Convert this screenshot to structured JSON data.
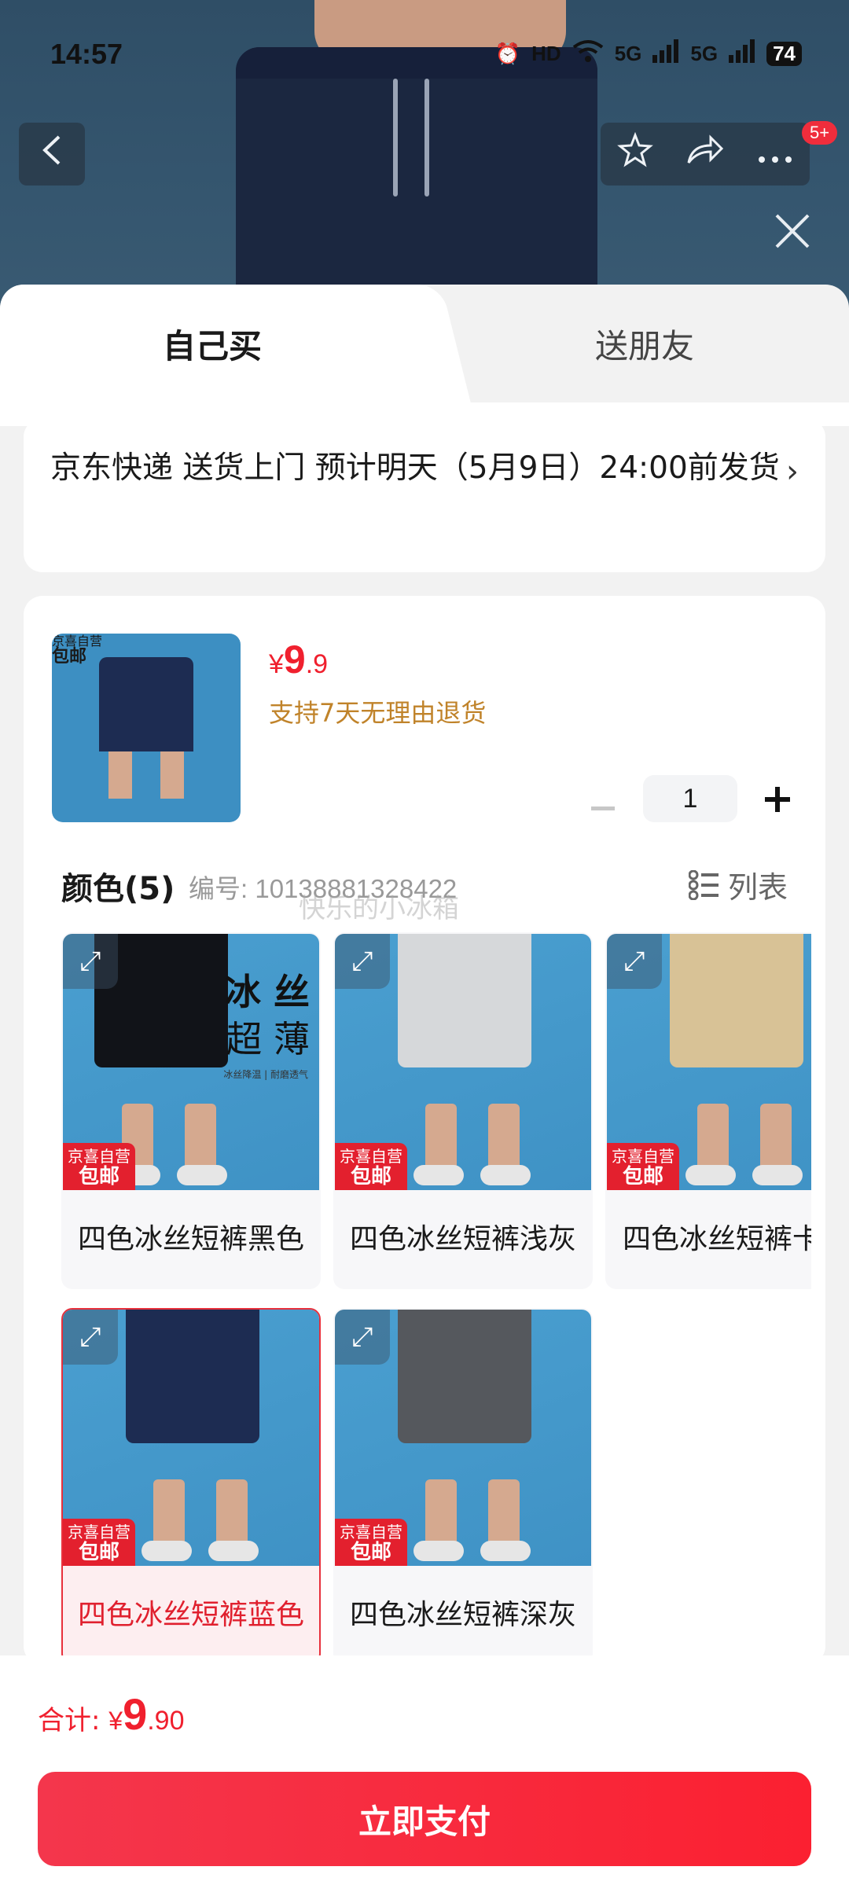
{
  "status_bar": {
    "time": "14:57",
    "battery": "74",
    "network": "5G",
    "hd": "HD"
  },
  "nav": {
    "back_icon": "chevron-left-icon",
    "favorite_icon": "star-icon",
    "share_icon": "share-icon",
    "more_icon": "more-icon",
    "notification_badge": "5+"
  },
  "tabs": [
    {
      "label": "自己买",
      "active": true
    },
    {
      "label": "送朋友",
      "active": false
    }
  ],
  "delivery": {
    "text": "京东快递 送货上门 预计明天（5月9日）24:00前发货"
  },
  "product": {
    "price_symbol": "¥",
    "price_int": "9",
    "price_dec": ".9",
    "return_policy": "支持7天无理由退货",
    "tag_top": "京喜自营",
    "tag_bottom": "包邮",
    "quantity": "1"
  },
  "color_section": {
    "title": "颜色(5)",
    "sku": "编号: 10138881328422",
    "watermark": "快乐的小冰箱",
    "list_toggle_label": "列表"
  },
  "variants": [
    {
      "name": "四色冰丝短裤黑色",
      "color": "#111318",
      "selected": false
    },
    {
      "name": "四色冰丝短裤浅灰",
      "color": "#d6d8da",
      "selected": false
    },
    {
      "name": "四色冰丝短裤卡其",
      "color": "#d8c296",
      "selected": false
    },
    {
      "name": "四色冰丝短裤蓝色",
      "color": "#1d2c52",
      "selected": true
    },
    {
      "name": "四色冰丝短裤深灰",
      "color": "#55585d",
      "selected": false
    }
  ],
  "promo": {
    "line1": "冰 丝",
    "line2": "超 薄",
    "line3": "冰丝降温 | 耐磨透气"
  },
  "footer": {
    "total_label": "合计: ",
    "total_symbol": "¥",
    "total_int": "9",
    "total_dec": ".90",
    "pay_label": "立即支付"
  },
  "colors": {
    "accent": "#f0202e",
    "return_note": "#c0832a"
  }
}
